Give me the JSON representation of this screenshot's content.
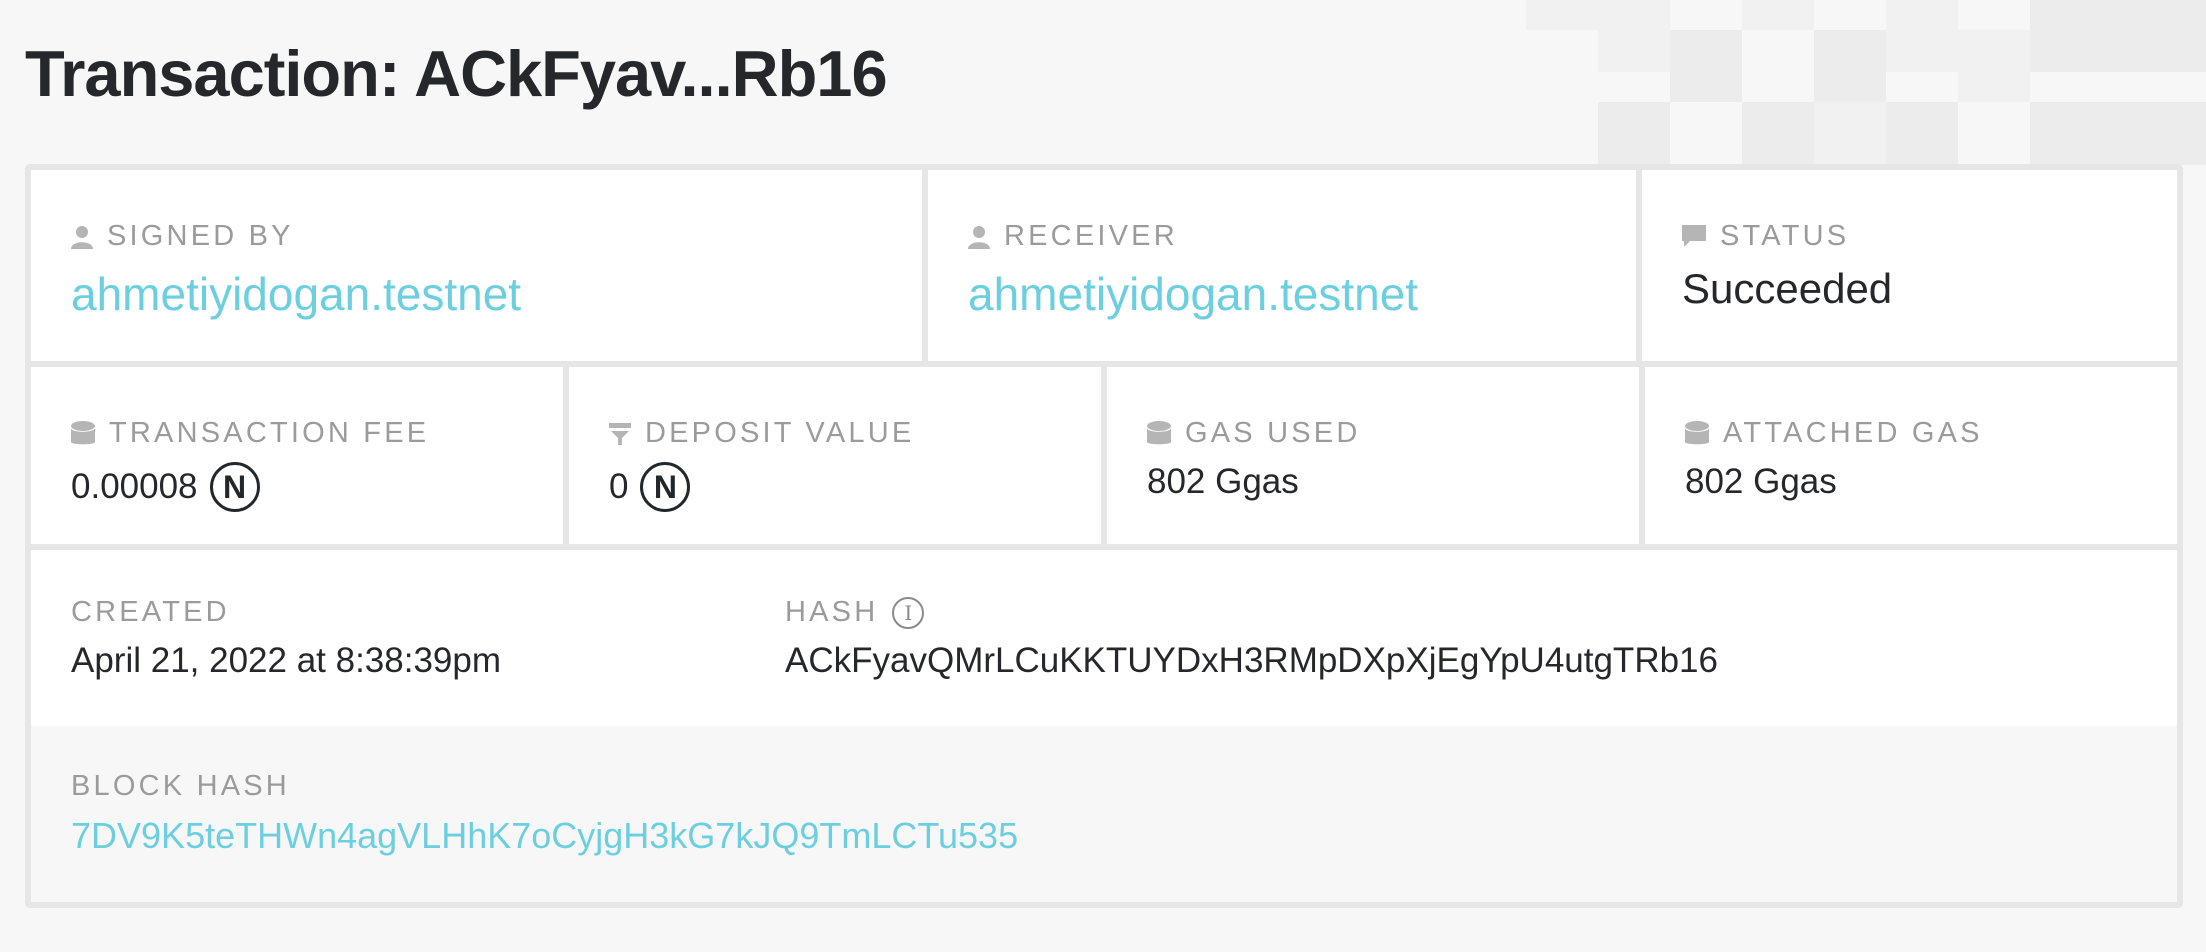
{
  "page": {
    "title": "Transaction: ACkFyav...Rb16"
  },
  "signed_by": {
    "label": "SIGNED BY",
    "value": "ahmetiyidogan.testnet",
    "icon": "user-icon"
  },
  "receiver": {
    "label": "RECEIVER",
    "value": "ahmetiyidogan.testnet",
    "icon": "user-icon"
  },
  "status": {
    "label": "STATUS",
    "value": "Succeeded",
    "icon": "comment-icon"
  },
  "transaction_fee": {
    "label": "TRANSACTION FEE",
    "value": "0.00008",
    "unit_icon": "near-token-icon",
    "icon": "database-icon"
  },
  "deposit_value": {
    "label": "DEPOSIT VALUE",
    "value": "0",
    "unit_icon": "near-token-icon",
    "icon": "filter-icon"
  },
  "gas_used": {
    "label": "GAS USED",
    "value": "802 Ggas",
    "icon": "database-icon"
  },
  "attached_gas": {
    "label": "ATTACHED GAS",
    "value": "802 Ggas",
    "icon": "database-icon"
  },
  "created": {
    "label": "CREATED",
    "value": "April 21, 2022 at 8:38:39pm"
  },
  "hash": {
    "label": "HASH",
    "value": "ACkFyavQMrLCuKKTUYDxH3RMpDXpXjEgYpU4utgTRb16",
    "icon": "info-icon"
  },
  "block_hash": {
    "label": "BLOCK HASH",
    "value": "7DV9K5teTHWn4agVLHhK7oCyjgH3kG7kJQ9TmLCTu535"
  },
  "colors": {
    "link": "#6ccfe0",
    "text": "#24272a",
    "muted": "#9b9b9b",
    "border": "#e6e6e6",
    "background": "#f7f7f7"
  }
}
